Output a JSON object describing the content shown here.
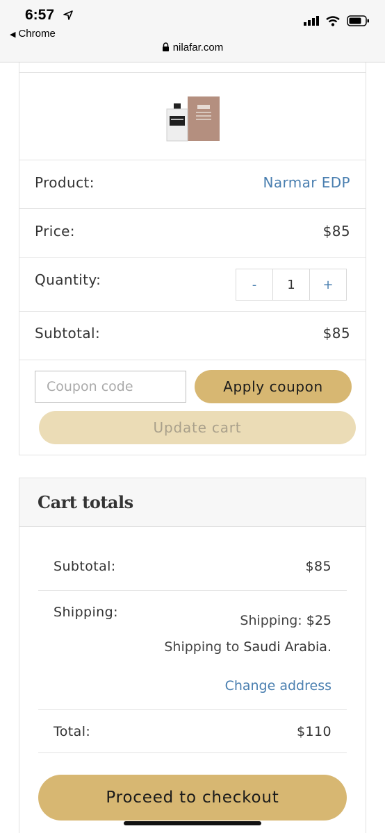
{
  "status_bar": {
    "time": "6:57",
    "back_app": "Chrome",
    "url": "nilafar.com",
    "icons": [
      "location-arrow-icon",
      "signal-icon",
      "wifi-icon",
      "battery-icon",
      "lock-icon"
    ]
  },
  "cart": {
    "product_label": "Product:",
    "product_name": "Narmar EDP",
    "price_label": "Price:",
    "price_value": "$85",
    "quantity_label": "Quantity:",
    "qty_minus": "-",
    "qty_value": "1",
    "qty_plus": "+",
    "subtotal_label": "Subtotal:",
    "subtotal_value": "$85",
    "coupon_placeholder": "Coupon code",
    "apply_coupon": "Apply coupon",
    "update_cart": "Update cart"
  },
  "totals": {
    "title": "Cart totals",
    "subtotal_label": "Subtotal:",
    "subtotal_value": "$85",
    "shipping_label": "Shipping:",
    "shipping_prefix": "Shipping: ",
    "shipping_value": "$25",
    "ship_to_prefix": "Shipping to ",
    "ship_to_country": "Saudi Arabia",
    "ship_to_suffix": ".",
    "change_address": "Change address",
    "total_label": "Total:",
    "total_value": "$110",
    "checkout": "Proceed to checkout"
  },
  "colors": {
    "accent_gold": "#d7b772",
    "accent_gold_light": "#ebdcb6",
    "link_blue": "#4a7fb0"
  }
}
